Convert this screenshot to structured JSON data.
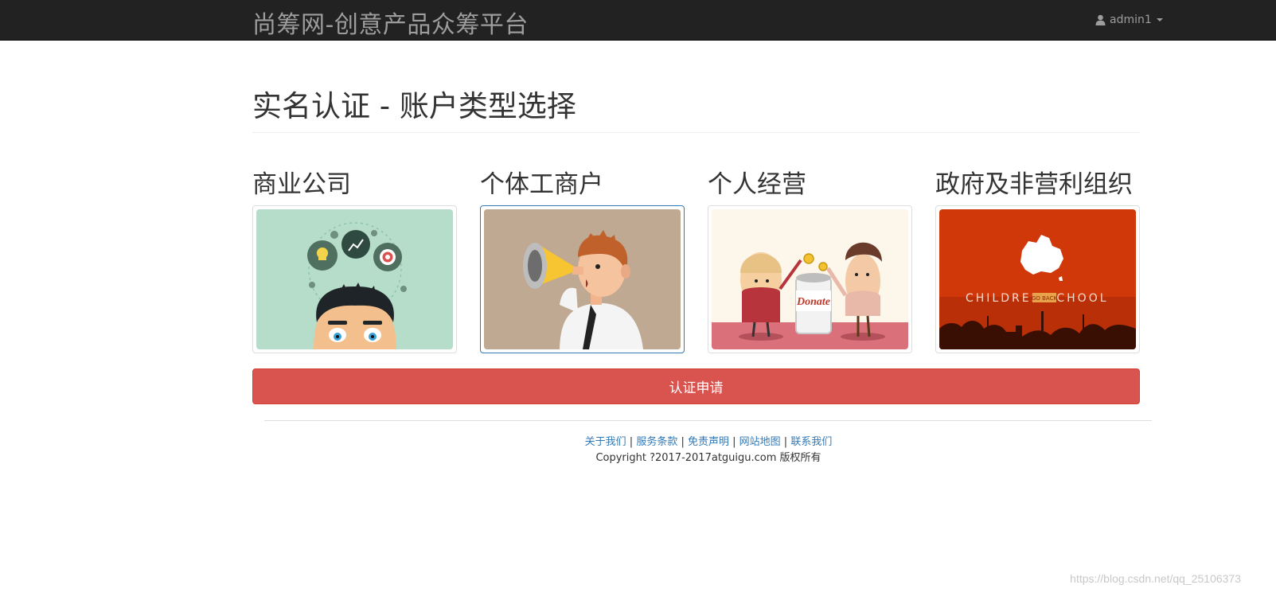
{
  "navbar": {
    "brand": "尚筹网-创意产品众筹平台",
    "user_name": "admin1"
  },
  "page": {
    "title": "实名认证 - 账户类型选择"
  },
  "account_types": [
    {
      "label": "商业公司",
      "image": "business-thinking-illustration",
      "selected": false
    },
    {
      "label": "个体工商户",
      "image": "megaphone-man-illustration",
      "selected": true
    },
    {
      "label": "个人经营",
      "image": "donate-can-illustration",
      "selected": false
    },
    {
      "label": "政府及非营利组织",
      "image": "children-school-illustration",
      "image_text": "CHILDREN",
      "image_text2": "SCHOOL",
      "image_tag": "GO BACK",
      "selected": false
    }
  ],
  "apply_button": "认证申请",
  "footer": {
    "links": [
      "关于我们",
      "服务条款",
      "免责声明",
      "网站地图",
      "联系我们"
    ],
    "separator": " | ",
    "copyright": "Copyright ?2017-2017atguigu.com 版权所有"
  },
  "watermark": "https://blog.csdn.net/qq_25106373",
  "colors": {
    "navbar_bg": "#222222",
    "danger": "#d9534f",
    "link": "#337ab7",
    "selected_border": "#337ab7"
  }
}
